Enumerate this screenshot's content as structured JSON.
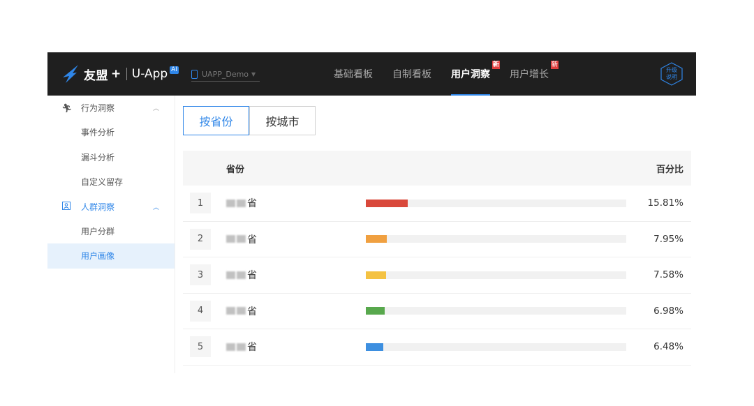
{
  "header": {
    "brand": "友盟",
    "plus": "+",
    "app": "U-App",
    "ai_badge": "AI",
    "app_select": "UAPP_Demo",
    "nav": [
      {
        "label": "基础看板",
        "badge": ""
      },
      {
        "label": "自制看板",
        "badge": ""
      },
      {
        "label": "用户洞察",
        "badge": "新",
        "active": true
      },
      {
        "label": "用户增长",
        "badge": "新"
      }
    ],
    "upgrade_line1": "升级",
    "upgrade_line2": "说明",
    "accent": "#2f86e8"
  },
  "sidebar": {
    "group1": {
      "label": "行为洞察",
      "icon": "running-icon"
    },
    "group1_items": [
      "事件分析",
      "漏斗分析",
      "自定义留存"
    ],
    "group2": {
      "label": "人群洞察",
      "icon": "person-card-icon"
    },
    "group2_items": [
      "用户分群",
      "用户画像"
    ],
    "active_item": "用户画像"
  },
  "main": {
    "toggle": [
      "按省份",
      "按城市"
    ],
    "active_toggle": "按省份",
    "table": {
      "col_province": "省份",
      "col_percent": "百分比",
      "rows": [
        {
          "rank": "1",
          "province": "省",
          "percent": "15.81%",
          "value": 0.1581,
          "color": "#d9483b"
        },
        {
          "rank": "2",
          "province": "省",
          "percent": "7.95%",
          "value": 0.0795,
          "color": "#f0a040"
        },
        {
          "rank": "3",
          "province": "省",
          "percent": "7.58%",
          "value": 0.0758,
          "color": "#f4c242"
        },
        {
          "rank": "4",
          "province": "省",
          "percent": "6.98%",
          "value": 0.0698,
          "color": "#58a84d"
        },
        {
          "rank": "5",
          "province": "省",
          "percent": "6.48%",
          "value": 0.0648,
          "color": "#3d8fe0"
        }
      ]
    }
  }
}
